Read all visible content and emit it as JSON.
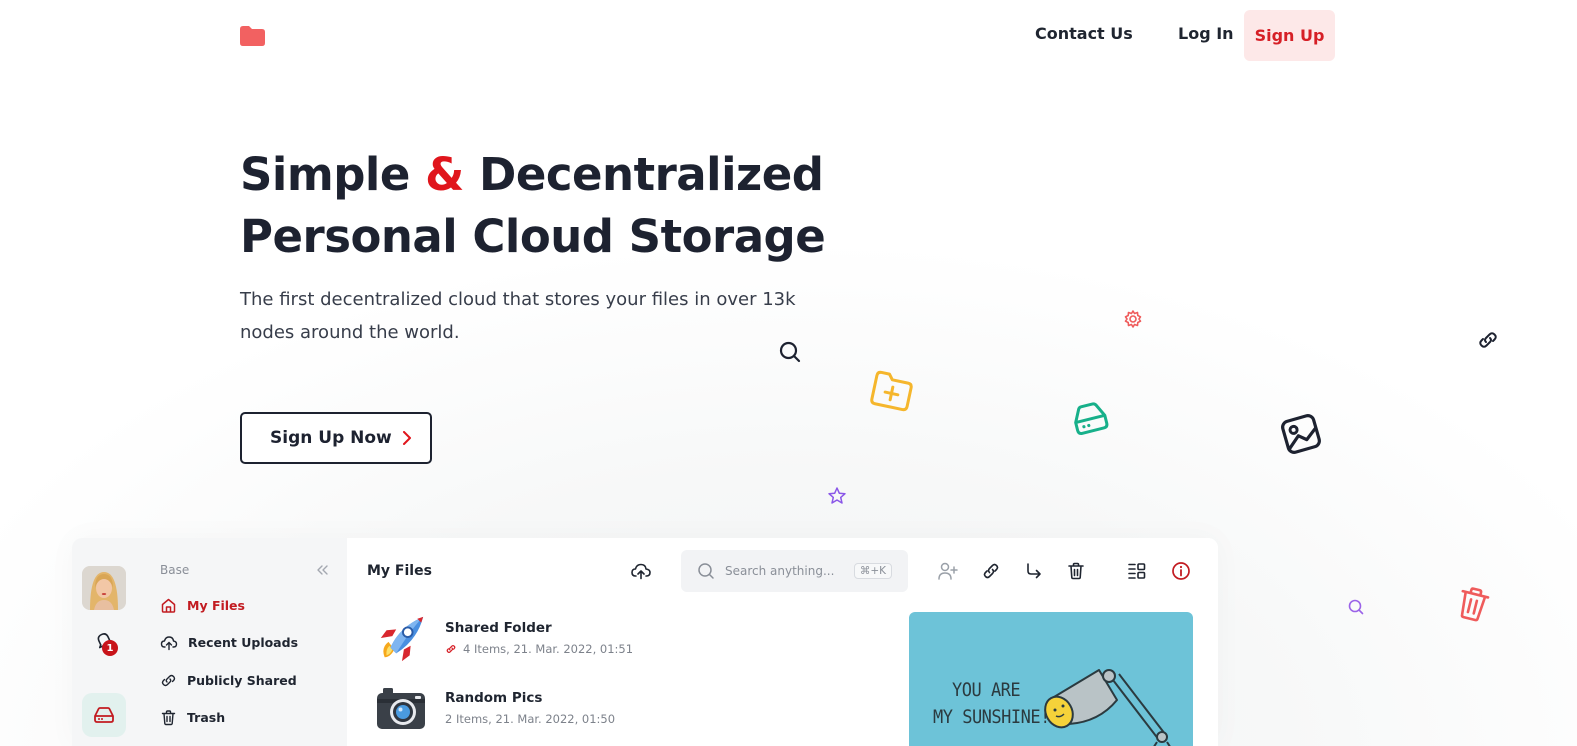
{
  "nav": {
    "contact": "Contact Us",
    "login": "Log In",
    "signup": "Sign Up"
  },
  "hero": {
    "title_part1": "Simple ",
    "title_amp": "&",
    "title_part2": " Decentralized",
    "title_line2": "Personal Cloud Storage",
    "subtitle": "The first decentralized cloud that stores your files in over 13k nodes around the world.",
    "cta": "Sign Up Now"
  },
  "app": {
    "rail": {
      "notification_count": "1"
    },
    "sidebar": {
      "section": "Base",
      "items": [
        {
          "label": "My Files",
          "icon": "home-icon",
          "active": true
        },
        {
          "label": "Recent Uploads",
          "icon": "cloud-upload-icon"
        },
        {
          "label": "Publicly Shared",
          "icon": "link-icon"
        },
        {
          "label": "Trash",
          "icon": "trash-icon"
        }
      ]
    },
    "main": {
      "title": "My Files",
      "search_placeholder": "Search anything...",
      "search_shortcut": "⌘+K",
      "files": [
        {
          "name": "Shared Folder",
          "meta": "4 Items, 21. Mar. 2022, 01:51",
          "shared": true,
          "icon": "rocket-icon"
        },
        {
          "name": "Random Pics",
          "meta": "2 Items, 21. Mar. 2022, 01:50",
          "shared": false,
          "icon": "camera-icon"
        }
      ],
      "preview_text_line1": "YOU ARE",
      "preview_text_line2": "MY SUNSHINE!"
    }
  },
  "colors": {
    "brand": "#e0151c",
    "dark": "#1d2230",
    "signup_bg": "#fde8e8"
  }
}
